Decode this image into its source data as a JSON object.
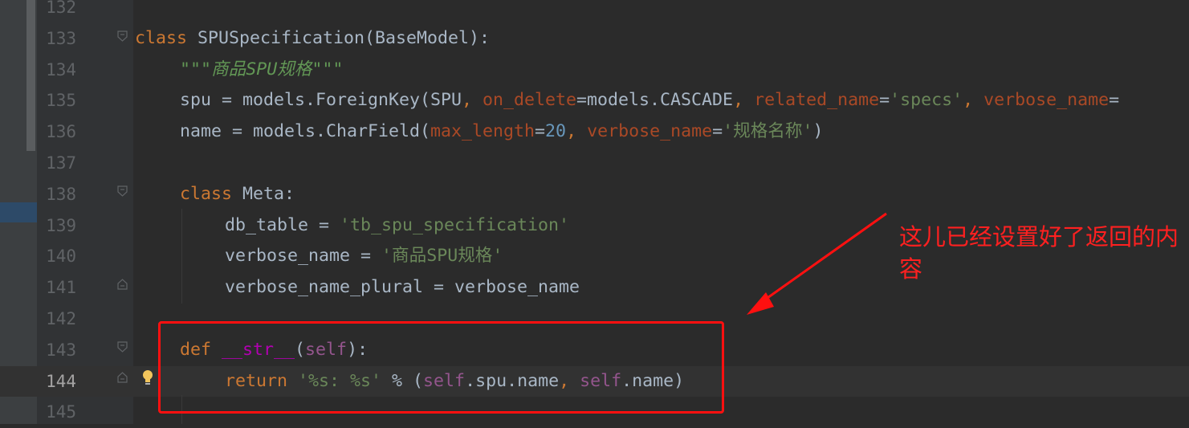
{
  "editor": {
    "lines": [
      {
        "num": "132"
      },
      {
        "num": "133",
        "tokens": [
          [
            "kw",
            "class "
          ],
          [
            "",
            "SPUSpecification(BaseModel):"
          ]
        ]
      },
      {
        "num": "134",
        "indent": 1,
        "tokens": [
          [
            "doc",
            "\"\"\"商品SPU规格\"\"\""
          ]
        ]
      },
      {
        "num": "135",
        "indent": 1,
        "tokens": [
          [
            "",
            "spu = models.ForeignKey(SPU"
          ],
          [
            "kw",
            ", "
          ],
          [
            "param",
            "on_delete"
          ],
          [
            "",
            "=models.CASCADE"
          ],
          [
            "kw",
            ", "
          ],
          [
            "param",
            "related_name"
          ],
          [
            "",
            "="
          ],
          [
            "str",
            "'specs'"
          ],
          [
            "kw",
            ", "
          ],
          [
            "param",
            "verbose_name"
          ],
          [
            "",
            "="
          ]
        ]
      },
      {
        "num": "136",
        "indent": 1,
        "tokens": [
          [
            "",
            "name = models.CharField("
          ],
          [
            "param",
            "max_length"
          ],
          [
            "",
            "="
          ],
          [
            "num",
            "20"
          ],
          [
            "kw",
            ", "
          ],
          [
            "param",
            "verbose_name"
          ],
          [
            "",
            "="
          ],
          [
            "str",
            "'规格名称'"
          ],
          [
            "",
            ")"
          ]
        ]
      },
      {
        "num": "137"
      },
      {
        "num": "138",
        "indent": 1,
        "tokens": [
          [
            "kw",
            "class "
          ],
          [
            "",
            "Meta:"
          ]
        ]
      },
      {
        "num": "139",
        "indent": 2,
        "tokens": [
          [
            "",
            "db_table = "
          ],
          [
            "str",
            "'tb_spu_specification'"
          ]
        ]
      },
      {
        "num": "140",
        "indent": 2,
        "tokens": [
          [
            "",
            "verbose_name = "
          ],
          [
            "str",
            "'商品SPU规格'"
          ]
        ]
      },
      {
        "num": "141",
        "indent": 2,
        "tokens": [
          [
            "",
            "verbose_name_plural = verbose_name"
          ]
        ]
      },
      {
        "num": "142"
      },
      {
        "num": "143",
        "indent": 1,
        "tokens": [
          [
            "kw",
            "def "
          ],
          [
            "magic",
            "__str__"
          ],
          [
            "",
            "("
          ],
          [
            "self",
            "self"
          ],
          [
            "",
            "):"
          ]
        ]
      },
      {
        "num": "144",
        "indent": 2,
        "tokens": [
          [
            "kw",
            "return "
          ],
          [
            "str",
            "'%s: %s'"
          ],
          [
            "",
            " % ("
          ],
          [
            "self",
            "self"
          ],
          [
            "",
            ".spu.name"
          ],
          [
            "kw",
            ", "
          ],
          [
            "self",
            "self"
          ],
          [
            "",
            ".name)"
          ]
        ]
      },
      {
        "num": "145"
      }
    ]
  },
  "annotation": {
    "text": "这儿已经设置好了返回的内容",
    "color": "#ff1010"
  },
  "colors": {
    "background": "#2b2b2b",
    "gutter": "#313335",
    "keyword": "#cc7832",
    "string": "#6a8759",
    "docstring": "#629755",
    "number": "#6897bb",
    "parameter": "#aa4926",
    "self": "#94558d",
    "magic": "#b200b2"
  }
}
